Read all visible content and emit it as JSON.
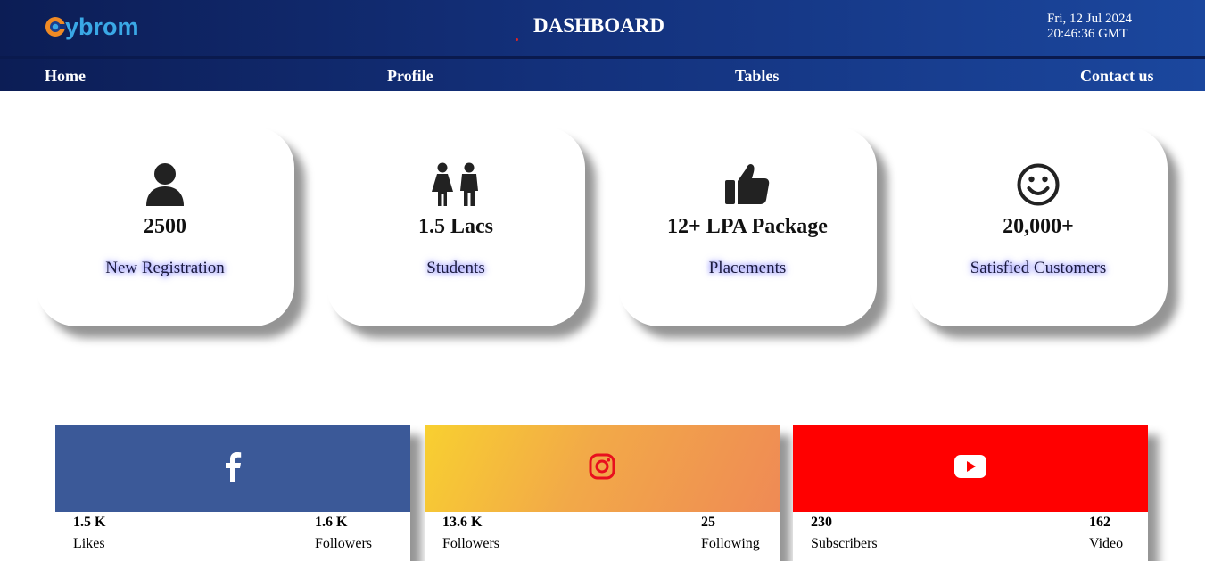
{
  "header": {
    "logo_text": "ybrom",
    "logo_letter": "C",
    "title": "DASHBOARD",
    "date": "Fri, 12 Jul 2024",
    "time": "20:46:36 GMT"
  },
  "nav": {
    "items": [
      {
        "label": "Home"
      },
      {
        "label": "Profile"
      },
      {
        "label": "Tables"
      },
      {
        "label": "Contact us"
      }
    ]
  },
  "stats": [
    {
      "icon": "user-icon",
      "value": "2500",
      "label": "New Registration"
    },
    {
      "icon": "children-icon",
      "value": "1.5 Lacs",
      "label": "Students"
    },
    {
      "icon": "thumbs-up-icon",
      "value": "12+ LPA Package",
      "label": "Placements"
    },
    {
      "icon": "smile-icon",
      "value": "20,000+",
      "label": "Satisfied Customers"
    }
  ],
  "social": [
    {
      "network": "facebook",
      "icon": "facebook-icon",
      "color": "#3b5998",
      "left_value": "1.5 K",
      "left_label": "Likes",
      "right_value": "1.6 K",
      "right_label": "Followers"
    },
    {
      "network": "instagram",
      "icon": "instagram-icon",
      "color": "#f2a948",
      "left_value": "13.6 K",
      "left_label": "Followers",
      "right_value": "25",
      "right_label": "Following"
    },
    {
      "network": "youtube",
      "icon": "youtube-icon",
      "color": "#ff0000",
      "left_value": "230",
      "left_label": "Subscribers",
      "right_value": "162",
      "right_label": "Video"
    }
  ],
  "colors": {
    "header_start": "#0c1d55",
    "header_end": "#1b479e",
    "logo_blue": "#3aa8e6",
    "logo_orange": "#f08a24",
    "label_glow": "#6a6aff"
  }
}
